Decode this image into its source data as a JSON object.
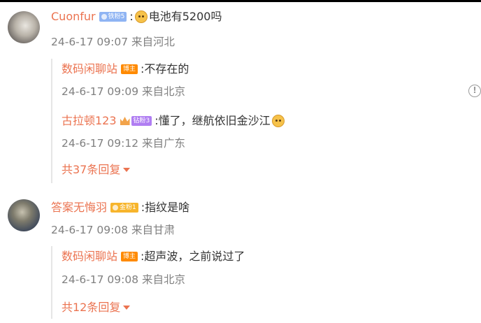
{
  "comments": [
    {
      "author": "Cuonfur",
      "badge": "铁粉5",
      "text": "电池有5200吗",
      "time": "24-6-17 09:07 来自河北",
      "replies": [
        {
          "author": "数码闲聊站",
          "badge": "博主",
          "text": ":不存在的",
          "time": "24-6-17 09:09 来自北京"
        },
        {
          "author": "古拉顿123",
          "badge": "钻粉3",
          "text": ":懂了，继航依旧金沙江",
          "time": "24-6-17 09:12 来自广东"
        }
      ],
      "more_label": "共37条回复"
    },
    {
      "author": "答案无悔羽",
      "badge": "金粉1",
      "text": ":指纹是啥",
      "time": "24-6-17 09:08 来自甘肃",
      "replies": [
        {
          "author": "数码闲聊站",
          "badge": "博主",
          "text": ":超声波，之前说过了",
          "time": "24-6-17 09:08 来自北京"
        }
      ],
      "more_label": "共12条回复"
    }
  ],
  "colors": {
    "name": "#eb7350",
    "meta": "#808080",
    "text": "#333333"
  },
  "icons": [
    "doge-emoji",
    "report-icon",
    "crown-icon",
    "caret-down-icon"
  ]
}
